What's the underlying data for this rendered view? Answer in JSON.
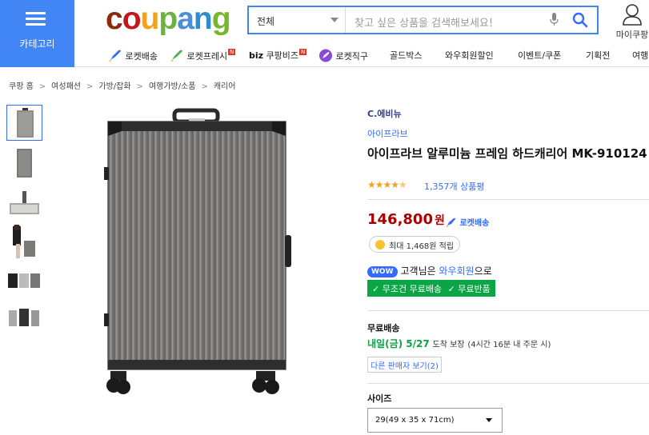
{
  "header": {
    "category_label": "카테고리",
    "logo": {
      "text": "coupang",
      "letters": [
        "c",
        "o",
        "u",
        "p",
        "a",
        "n",
        "g"
      ],
      "colors": [
        "#8a2b0e",
        "#c4161c",
        "#f4a21c",
        "#6cb33e",
        "#4a90d9",
        "#2e8dd0",
        "#76b82a"
      ]
    },
    "search": {
      "category": "전체",
      "placeholder": "찾고 싶은 상품을 검색해보세요!"
    },
    "mypage_label": "마이쿠팡"
  },
  "nav": {
    "items": [
      {
        "label": "로켓배송",
        "icon": "rocket-icon"
      },
      {
        "label": "로켓프레시",
        "icon": "rocket-fresh-icon",
        "badge": "N"
      },
      {
        "label": "쿠팡비즈",
        "prefix": "biz",
        "badge": "N"
      },
      {
        "label": "로켓직구",
        "icon": "rocket-global-icon"
      },
      {
        "label": "골드박스"
      },
      {
        "label": "와우회원할인"
      },
      {
        "label": "이벤트/쿠폰"
      },
      {
        "label": "기획전"
      },
      {
        "label": "여행"
      }
    ]
  },
  "breadcrumb": [
    "쿠팡 홈",
    "여성패션",
    "가방/잡화",
    "여행가방/소품",
    "캐리어"
  ],
  "product": {
    "brand": "C.에비뉴",
    "store": "아이프라브",
    "title": "아이프라브 알루미늄 프레임 하드캐리어 MK-910124",
    "rating": 4.5,
    "review_count": "1,357개 상품평",
    "price": "146,800",
    "currency": "원",
    "delivery_badge": "로켓배송",
    "cashback": "최대 1,468원 적립",
    "wow": {
      "badge": "WOW",
      "prefix": "고객님은 ",
      "highlight": "와우회원",
      "suffix": "으로"
    },
    "free_benefits": [
      "무조건 무료배송",
      "무료반품"
    ],
    "shipping_label": "무료배송",
    "shipping_date": "내일(금) 5/27",
    "shipping_arrive": "도착 보장",
    "shipping_note": "(4시간 16분 내 주문 시)",
    "other_sellers": "다른 판매자 보기(2)",
    "size_label": "사이즈",
    "size_selected": "29(49 x 35 x 71cm)"
  },
  "colors": {
    "accent": "#346aff",
    "price": "#ae0000",
    "green": "#0aa544",
    "category": "#4285f4"
  }
}
